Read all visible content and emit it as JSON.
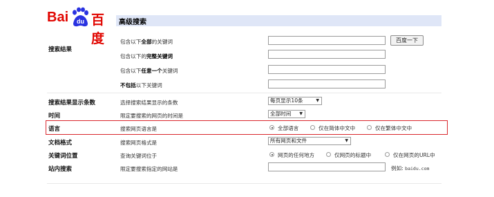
{
  "header": {
    "logo_bai": "Bai",
    "logo_du": "du",
    "logo_cn": "百度",
    "title": "高级搜索"
  },
  "search_results": {
    "label": "搜索结果",
    "rows": [
      {
        "pre": "包含以下",
        "bold": "全部",
        "post": "的关键词"
      },
      {
        "pre": "包含以下的",
        "bold": "完整关键词",
        "post": ""
      },
      {
        "pre": "包含以下",
        "bold": "任意一个",
        "post": "关键词"
      },
      {
        "pre": "",
        "bold": "不包括",
        "post": "以下关键词"
      }
    ],
    "search_button": "百度一下"
  },
  "result_count": {
    "label": "搜索结果显示条数",
    "desc": "选择搜索结果显示的条数",
    "select_value": "每页显示10条"
  },
  "time": {
    "label": "时间",
    "desc": "限定要搜索的网页的时间是",
    "select_value": "全部时间"
  },
  "language": {
    "label": "语言",
    "desc": "搜索网页语言是",
    "options": [
      "全部语言",
      "仅在简体中文中",
      "仅在繁体中文中"
    ],
    "selected_index": 0
  },
  "format": {
    "label": "文档格式",
    "desc": "搜索网页格式是",
    "select_value": "所有网页和文件"
  },
  "keyword_position": {
    "label": "关键词位置",
    "desc": "查询关键词位于",
    "options": [
      "网页的任何地方",
      "仅网页的标题中",
      "仅在网页的URL中"
    ],
    "selected_index": 0
  },
  "site_search": {
    "label": "站内搜索",
    "desc": "限定要搜索指定的网站是",
    "example_prefix": "例如:",
    "example_value": "baidu.com"
  },
  "colors": {
    "accent_red": "#d9262c",
    "baidu_blue": "#2932e1",
    "baidu_red": "#e10601",
    "header_bg": "#dfe6f7"
  },
  "icons": {
    "logo_paw": "paw-icon",
    "dropdown_arrow": "chevron-down-icon"
  }
}
